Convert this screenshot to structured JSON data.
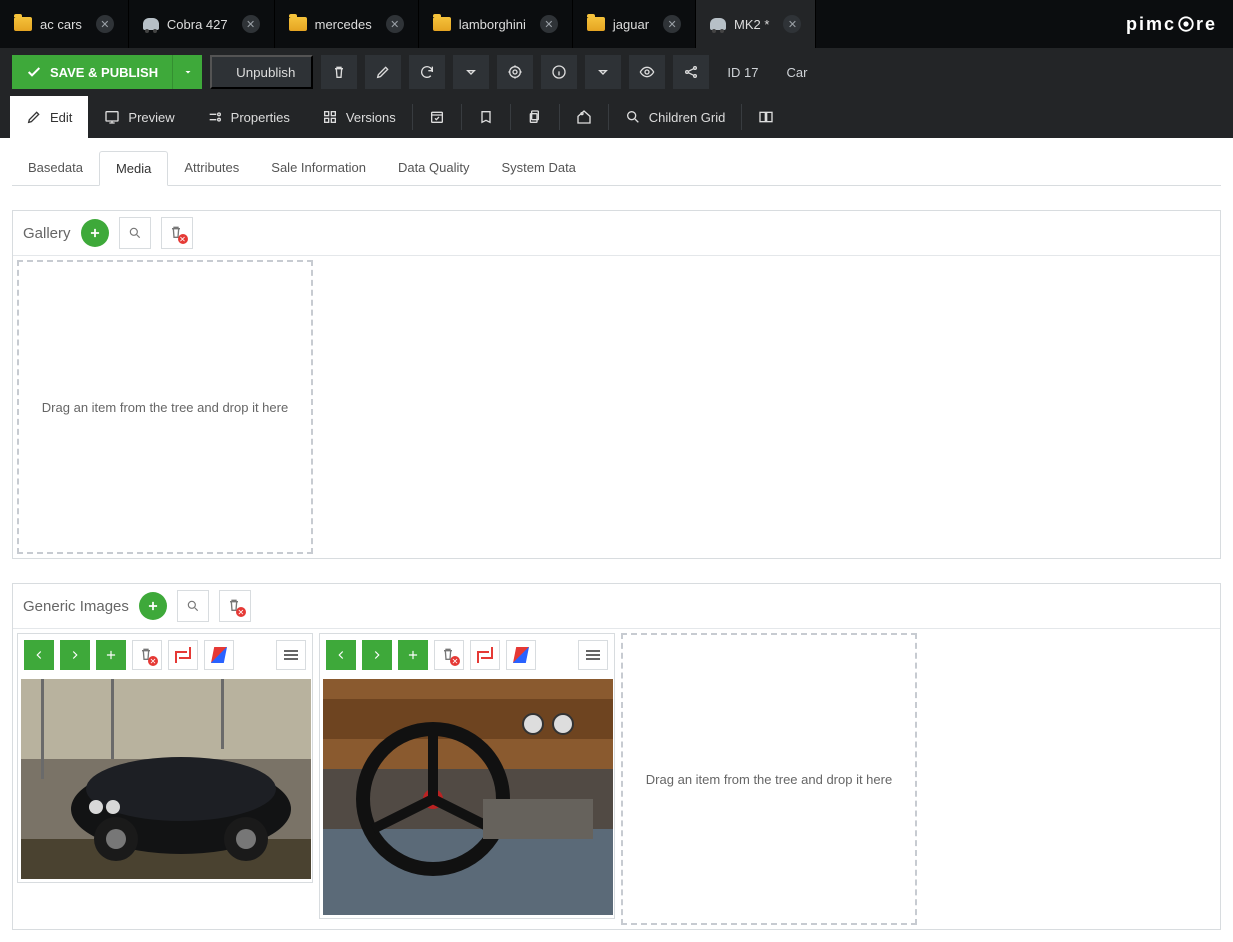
{
  "logo": "pimcore",
  "tabs": [
    {
      "type": "folder",
      "label": "ac cars"
    },
    {
      "type": "object",
      "label": "Cobra 427"
    },
    {
      "type": "folder",
      "label": "mercedes"
    },
    {
      "type": "folder",
      "label": "lamborghini"
    },
    {
      "type": "folder",
      "label": "jaguar"
    },
    {
      "type": "object",
      "label": "MK2 *",
      "active": true
    }
  ],
  "actions": {
    "save_publish": "SAVE & PUBLISH",
    "unpublish": "Unpublish",
    "id_label": "ID 17",
    "type_label": "Car"
  },
  "secnav": [
    {
      "label": "Edit",
      "active": true
    },
    {
      "label": "Preview"
    },
    {
      "label": "Properties"
    },
    {
      "label": "Versions"
    },
    {
      "label": "Children Grid"
    }
  ],
  "subtabs": [
    {
      "label": "Basedata"
    },
    {
      "label": "Media",
      "active": true
    },
    {
      "label": "Attributes"
    },
    {
      "label": "Sale Information"
    },
    {
      "label": "Data Quality"
    },
    {
      "label": "System Data"
    }
  ],
  "panels": {
    "gallery": {
      "title": "Gallery",
      "drop_hint": "Drag an item from the tree and drop it here"
    },
    "generic": {
      "title": "Generic Images",
      "drop_hint": "Drag an item from the tree and drop it here",
      "images": [
        {
          "alt": "classic black car exterior"
        },
        {
          "alt": "car interior steering wheel"
        }
      ]
    }
  }
}
